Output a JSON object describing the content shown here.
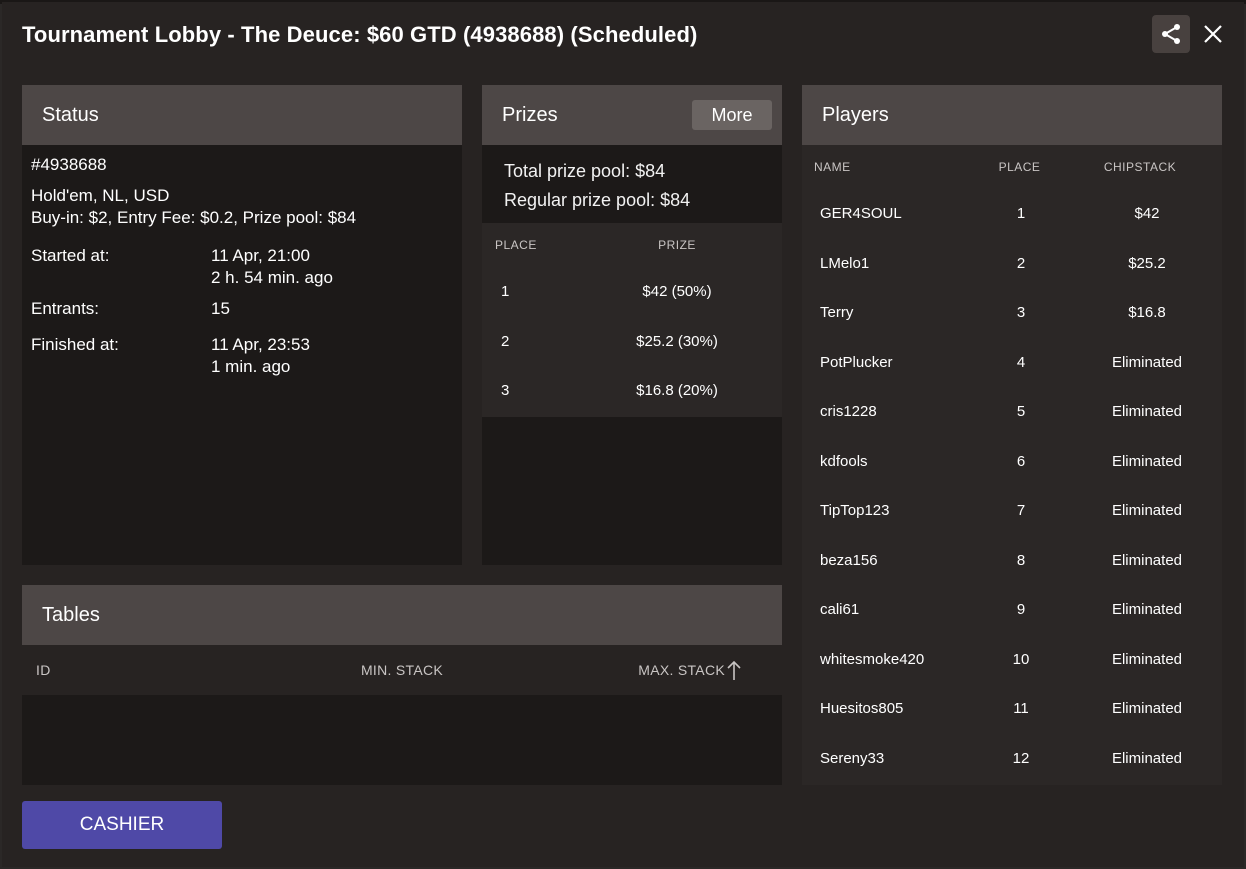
{
  "window": {
    "title": "Tournament Lobby - The Deuce: $60 GTD (4938688) (Scheduled)"
  },
  "status": {
    "header": "Status",
    "id": "#4938688",
    "game": "Hold'em, NL, USD",
    "buyin": "Buy-in: $2, Entry Fee: $0.2, Prize pool: $84",
    "started_label": "Started at:",
    "started_value": "11 Apr, 21:00",
    "started_ago": "2 h. 54 min. ago",
    "entrants_label": "Entrants:",
    "entrants_value": "15",
    "finished_label": "Finished at:",
    "finished_value": "11 Apr, 23:53",
    "finished_ago": "1 min. ago"
  },
  "prizes": {
    "header": "Prizes",
    "more_label": "More",
    "total_pool": "Total prize pool: $84",
    "regular_pool": "Regular prize pool: $84",
    "col_place": "PLACE",
    "col_prize": "PRIZE",
    "rows": [
      {
        "place": "1",
        "prize": "$42 (50%)"
      },
      {
        "place": "2",
        "prize": "$25.2 (30%)"
      },
      {
        "place": "3",
        "prize": "$16.8 (20%)"
      }
    ]
  },
  "players": {
    "header": "Players",
    "col_name": "NAME",
    "col_place": "PLACE",
    "col_chip": "CHIPSTACK",
    "rows": [
      {
        "name": "GER4SOUL",
        "place": "1",
        "chip": "$42"
      },
      {
        "name": "LMelo1",
        "place": "2",
        "chip": "$25.2"
      },
      {
        "name": "Terry",
        "place": "3",
        "chip": "$16.8"
      },
      {
        "name": "PotPlucker",
        "place": "4",
        "chip": "Eliminated"
      },
      {
        "name": "cris1228",
        "place": "5",
        "chip": "Eliminated"
      },
      {
        "name": "kdfools",
        "place": "6",
        "chip": "Eliminated"
      },
      {
        "name": "TipTop123",
        "place": "7",
        "chip": "Eliminated"
      },
      {
        "name": "beza156",
        "place": "8",
        "chip": "Eliminated"
      },
      {
        "name": "cali61",
        "place": "9",
        "chip": "Eliminated"
      },
      {
        "name": "whitesmoke420",
        "place": "10",
        "chip": "Eliminated"
      },
      {
        "name": "Huesitos805",
        "place": "11",
        "chip": "Eliminated"
      },
      {
        "name": "Sereny33",
        "place": "12",
        "chip": "Eliminated"
      }
    ]
  },
  "tables": {
    "header": "Tables",
    "col_id": "ID",
    "col_min": "MIN. STACK",
    "col_max": "MAX. STACK"
  },
  "footer": {
    "cashier_label": "CASHIER"
  },
  "icons": {
    "share": "share-icon",
    "close": "close-icon",
    "sort": "arrow-up-icon"
  },
  "colors": {
    "cashier": "#4f49a7",
    "panel_header": "#4d4746"
  }
}
